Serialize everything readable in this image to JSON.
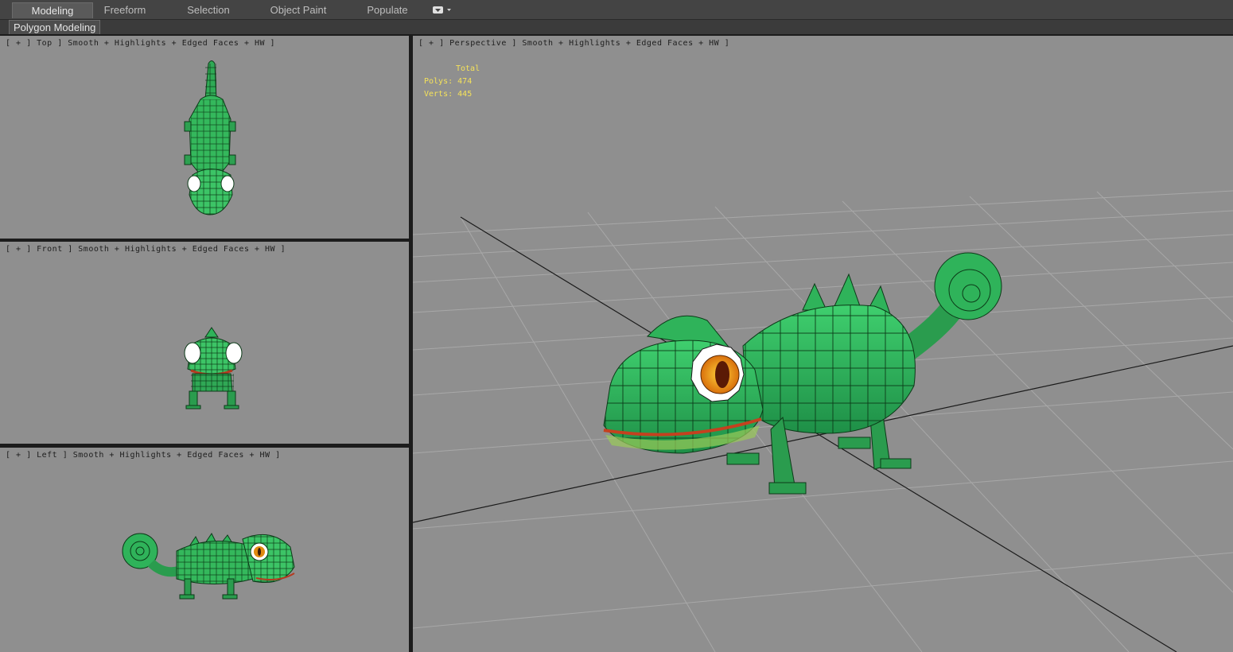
{
  "ribbon": {
    "tabs": [
      {
        "label": "Modeling",
        "active": true
      },
      {
        "label": "Freeform",
        "active": false
      },
      {
        "label": "Selection",
        "active": false
      },
      {
        "label": "Object Paint",
        "active": false
      },
      {
        "label": "Populate",
        "active": false
      }
    ],
    "dropdown_icon": "camera-dropdown-icon",
    "panel_label": "Polygon Modeling"
  },
  "viewports": {
    "top": {
      "label": "[ + ] Top ] Smooth + Highlights + Edged Faces + HW ]"
    },
    "front": {
      "label": "[ + ] Front ] Smooth + Highlights + Edged Faces + HW ]"
    },
    "left": {
      "label": "[ + ] Left ] Smooth + Highlights + Edged Faces + HW ]"
    },
    "perspective": {
      "label": "[ + ] Perspective ] Smooth + Highlights + Edged Faces + HW ]"
    }
  },
  "stats": {
    "total_label": "Total",
    "polys_label": "Polys:",
    "polys_value": "474",
    "verts_label": "Verts:",
    "verts_value": "445"
  },
  "colors": {
    "viewport_bg": "#8f8f8f",
    "model_green": "#2fb35a",
    "stats_yellow": "#f5e25a",
    "eye_orange": "#e08a10"
  }
}
